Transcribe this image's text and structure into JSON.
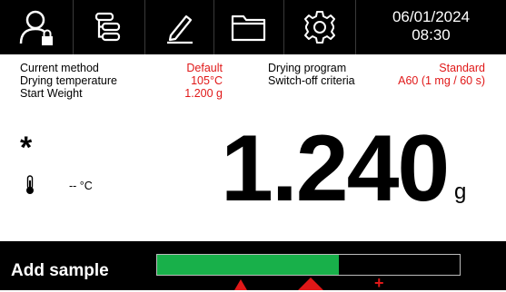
{
  "clock": {
    "date": "06/01/2024",
    "time": "08:30"
  },
  "toolbar": {
    "icons": [
      "user-lock-icon",
      "method-tree-icon",
      "edit-pencil-icon",
      "folder-icon",
      "settings-gear-icon"
    ]
  },
  "method": {
    "current_method_label": "Current method",
    "current_method_value": "Default",
    "drying_temp_label": "Drying temperature",
    "drying_temp_value": "105°C",
    "start_weight_label": "Start Weight",
    "start_weight_value": "1.200 g"
  },
  "program": {
    "drying_program_label": "Drying program",
    "drying_program_value": "Standard",
    "switch_off_label": "Switch-off criteria",
    "switch_off_value": "A60 (1 mg / 60 s)"
  },
  "status": {
    "stability_symbol": "*",
    "temperature_readout": "-- °C"
  },
  "weight": {
    "value": "1.240",
    "unit": "g"
  },
  "sample": {
    "label": "Add sample",
    "progress_fraction": 0.6
  },
  "colors": {
    "accent_red": "#e01818",
    "progress_green": "#18b04a"
  }
}
